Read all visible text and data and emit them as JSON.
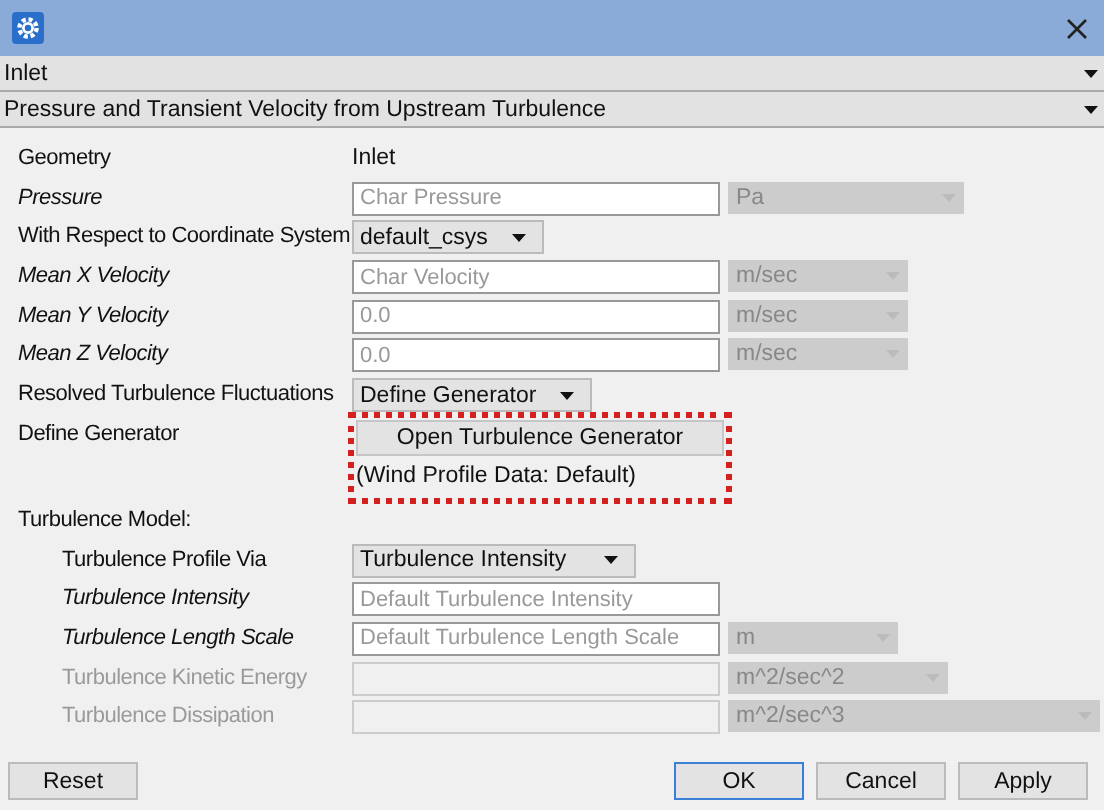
{
  "sections": [
    {
      "label": "Inlet",
      "expanded": true
    },
    {
      "label": "Pressure and Transient Velocity from Upstream Turbulence",
      "expanded": true
    }
  ],
  "rows": [
    {
      "kind": "text",
      "label": "Geometry",
      "italic": false,
      "value": "Inlet"
    },
    {
      "kind": "field",
      "label": "Pressure",
      "italic": true,
      "placeholder": "Char Pressure",
      "unit": "Pa",
      "disabled": false
    },
    {
      "kind": "select",
      "label": "With Respect to Coordinate System",
      "italic": false,
      "value": "default_csys"
    },
    {
      "kind": "field",
      "label": "Mean X Velocity",
      "italic": true,
      "placeholder": "Char Velocity",
      "unit": "m/sec",
      "disabled": false
    },
    {
      "kind": "field",
      "label": "Mean Y Velocity",
      "italic": true,
      "placeholder": "0.0",
      "unit": "m/sec",
      "disabled": false
    },
    {
      "kind": "field",
      "label": "Mean Z Velocity",
      "italic": true,
      "placeholder": "0.0",
      "unit": "m/sec",
      "disabled": false
    },
    {
      "kind": "select",
      "label": "Resolved Turbulence Fluctuations",
      "italic": false,
      "value": "Define Generator"
    },
    {
      "kind": "generator",
      "label": "Define Generator",
      "italic": false,
      "button": "Open Turbulence Generator",
      "note": "(Wind Profile Data: Default)",
      "highlighted": true
    },
    {
      "kind": "group",
      "label": "Turbulence Model:",
      "italic": false,
      "children": [
        {
          "kind": "select",
          "label": "Turbulence Profile Via",
          "italic": false,
          "value": "Turbulence Intensity"
        },
        {
          "kind": "field",
          "label": "Turbulence Intensity",
          "italic": true,
          "placeholder": "Default Turbulence Intensity",
          "disabled": false
        },
        {
          "kind": "field",
          "label": "Turbulence Length Scale",
          "italic": true,
          "placeholder": "Default Turbulence Length Scale",
          "unit": "m",
          "disabled": false
        },
        {
          "kind": "field",
          "label": "Turbulence Kinetic Energy",
          "italic": false,
          "unit": "m^2/sec^2",
          "disabled": true
        },
        {
          "kind": "field",
          "label": "Turbulence Dissipation",
          "italic": false,
          "unit": "m^2/sec^3",
          "disabled": true
        }
      ]
    }
  ],
  "buttons": [
    {
      "label": "Reset",
      "default": false
    },
    {
      "label": "OK",
      "default": true
    },
    {
      "label": "Cancel",
      "default": false
    },
    {
      "label": "Apply",
      "default": false
    }
  ]
}
